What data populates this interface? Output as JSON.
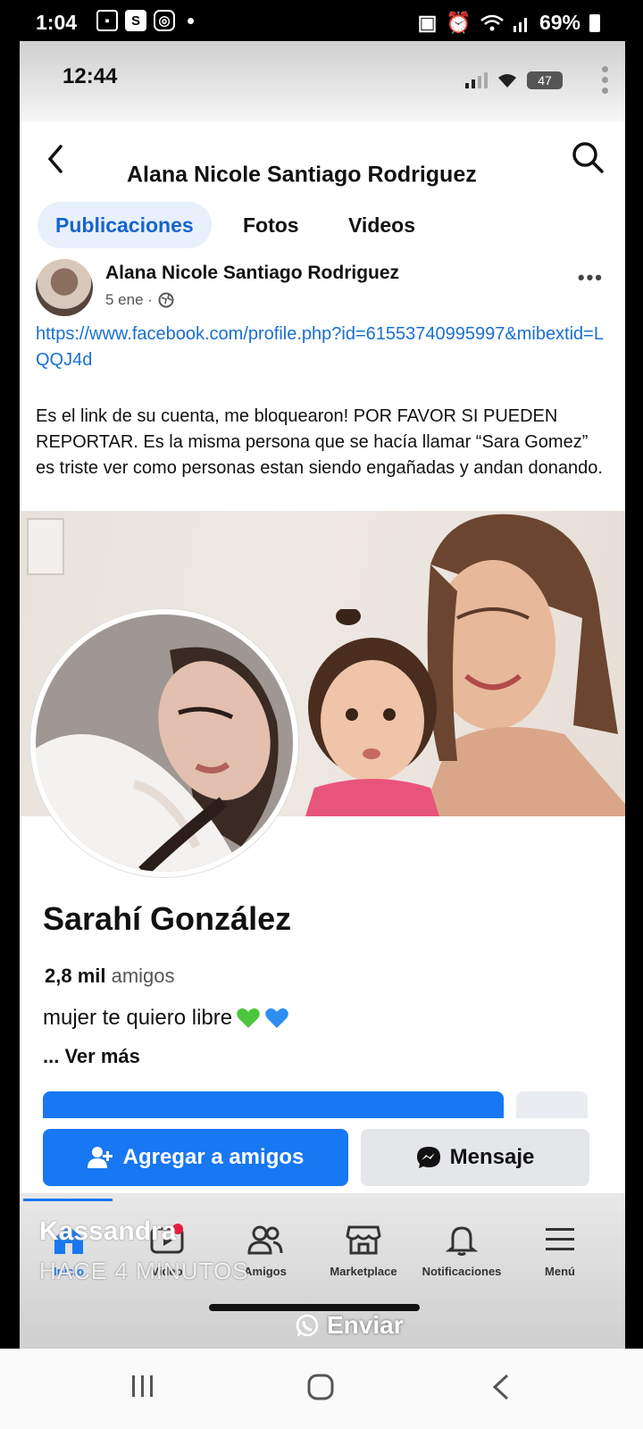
{
  "outer_status": {
    "time": "1:04",
    "battery": "69%",
    "s_badge": "S"
  },
  "inner_status": {
    "time": "12:44",
    "battery": "47"
  },
  "navbar": {
    "title": "Alana Nicole Santiago Rodriguez"
  },
  "tabs": [
    {
      "label": "Publicaciones",
      "active": true
    },
    {
      "label": "Fotos",
      "active": false
    },
    {
      "label": "Videos",
      "active": false
    }
  ],
  "post": {
    "author": "Alana Nicole Santiago Rodriguez",
    "date": "5 ene ·",
    "link": "https://www.facebook.com/profile.php?id=61553740995997&mibextid=LQQJ4d",
    "text": "Es el link de su cuenta, me bloquearon! POR FAVOR SI PUEDEN REPORTAR. Es la misma persona que se hacía llamar “Sara Gomez” es triste ver como personas estan siendo engañadas y andan donando."
  },
  "profile": {
    "name": "Sarahí González",
    "friends_count": "2,8 mil",
    "friends_label": "amigos",
    "bio": "mujer te quiero libre",
    "see_more": "... Ver más",
    "add_friend_label": "Agregar a amigos",
    "message_label": "Mensaje"
  },
  "bottom_nav": [
    {
      "label": "Inicio",
      "icon": "home-icon",
      "active": true
    },
    {
      "label": "Video",
      "icon": "video-icon",
      "active": false
    },
    {
      "label": "Amigos",
      "icon": "friends-icon",
      "active": false
    },
    {
      "label": "Marketplace",
      "icon": "marketplace-icon",
      "active": false
    },
    {
      "label": "Notificaciones",
      "icon": "bell-icon",
      "active": false
    },
    {
      "label": "Menú",
      "icon": "menu-icon",
      "active": false
    }
  ],
  "overlay": {
    "sender": "Kassandra",
    "time_ago": "HACE 4 MINUTOS",
    "send_label": "Enviar"
  },
  "colors": {
    "facebook_blue": "#1877f2",
    "link_blue": "#1a6fd1"
  }
}
